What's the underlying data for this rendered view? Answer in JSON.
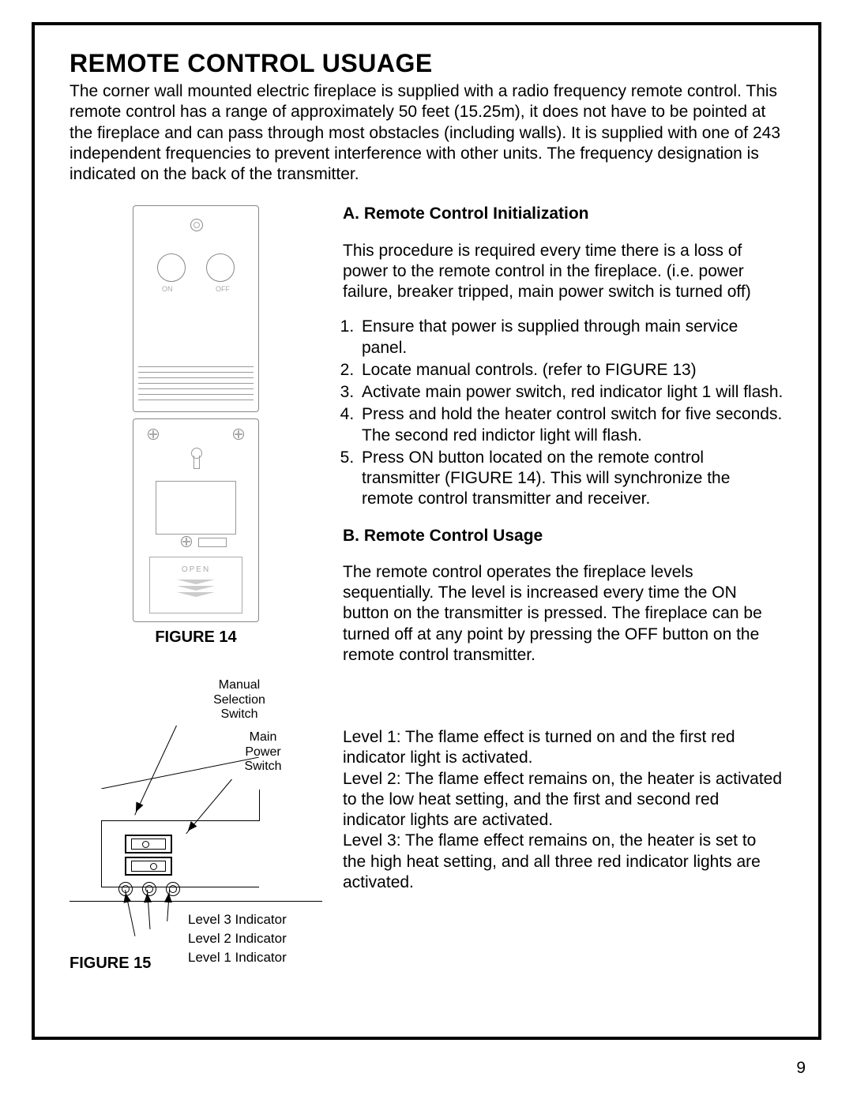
{
  "page_number": "9",
  "title": "REMOTE CONTROL USUAGE",
  "intro": "The corner wall mounted electric fireplace is supplied with a radio frequency remote control. This remote control has a range of approximately 50 feet (15.25m), it does not have to be pointed at the fireplace and can pass through most obstacles (including walls).  It is supplied with one of 243 independent frequencies to prevent interference with other units.  The frequency designation is indicated on the back of the transmitter.",
  "figure14": {
    "label": "FIGURE 14",
    "on_label": "ON",
    "off_label": "OFF",
    "open_label": "OPEN"
  },
  "figure15": {
    "label": "FIGURE 15",
    "manual_switch": "Manual Selection Switch",
    "main_power": "Main Power Switch",
    "ind3": "Level 3 Indicator",
    "ind2": "Level 2 Indicator",
    "ind1": "Level 1 Indicator"
  },
  "sectionA": {
    "heading": "A.  Remote Control Initialization",
    "para": "This procedure is required every time there is a loss of power to the remote control in the fireplace.  (i.e. power failure, breaker tripped, main power switch is turned off)",
    "steps": [
      "Ensure that power is supplied through main service panel.",
      "Locate manual controls. (refer to FIGURE 13)",
      "Activate main power switch, red indicator light 1 will flash.",
      "Press and hold the heater control switch for five seconds.  The second red indictor light will flash.",
      "Press ON button located on the remote control transmitter (FIGURE 14).  This will synchronize the remote control transmitter and receiver."
    ]
  },
  "sectionB": {
    "heading": "B.  Remote Control Usage",
    "para": "The remote control operates the fireplace levels sequentially.  The level is increased every time the ON button on the transmitter is pressed.  The fireplace can be turned off at any point by pressing the OFF button on the remote control transmitter.",
    "levels": "Level 1:  The flame effect is turned on and the first red indicator light is activated.\nLevel 2:  The flame effect remains on, the heater is activated to the low heat setting, and the first and second red indicator lights are activated.\nLevel 3:  The flame effect remains on, the heater is set to the high heat setting, and all three red indicator lights are activated."
  }
}
